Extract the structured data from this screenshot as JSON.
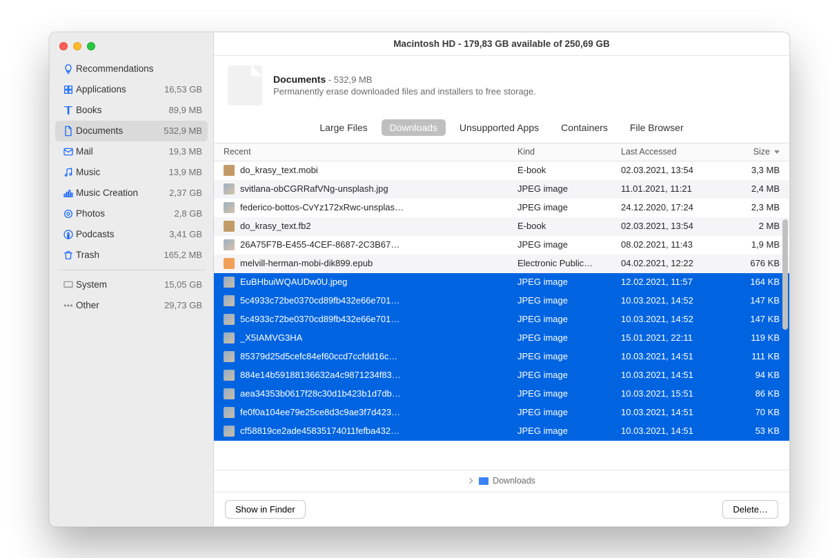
{
  "window_title": "Macintosh HD - 179,83 GB available of 250,69 GB",
  "sidebar": [
    {
      "icon": "bulb",
      "label": "Recommendations",
      "size": ""
    },
    {
      "icon": "apps",
      "label": "Applications",
      "size": "16,53 GB"
    },
    {
      "icon": "book",
      "label": "Books",
      "size": "89,9 MB"
    },
    {
      "icon": "doc",
      "label": "Documents",
      "size": "532,9 MB",
      "selected": true
    },
    {
      "icon": "mail",
      "label": "Mail",
      "size": "19,3 MB"
    },
    {
      "icon": "music",
      "label": "Music",
      "size": "13,9 MB"
    },
    {
      "icon": "musiccreation",
      "label": "Music Creation",
      "size": "2,37 GB"
    },
    {
      "icon": "photos",
      "label": "Photos",
      "size": "2,8 GB"
    },
    {
      "icon": "podcasts",
      "label": "Podcasts",
      "size": "3,41 GB"
    },
    {
      "icon": "trash",
      "label": "Trash",
      "size": "165,2 MB"
    },
    {
      "divider": true
    },
    {
      "icon": "system",
      "gray": true,
      "label": "System",
      "size": "15,05 GB"
    },
    {
      "icon": "other",
      "gray": true,
      "label": "Other",
      "size": "29,73 GB"
    }
  ],
  "header": {
    "title": "Documents",
    "title_suffix": "- 532,9 MB",
    "subtitle": "Permanently erase downloaded files and installers to free storage."
  },
  "tabs": [
    {
      "label": "Large Files"
    },
    {
      "label": "Downloads",
      "selected": true
    },
    {
      "label": "Unsupported Apps"
    },
    {
      "label": "Containers"
    },
    {
      "label": "File Browser"
    }
  ],
  "columns": {
    "name": "Recent",
    "kind": "Kind",
    "last": "Last Accessed",
    "size": "Size",
    "sort": "size-desc"
  },
  "rows": [
    {
      "thumb": "ebook",
      "name": "do_krasy_text.mobi",
      "kind": "E-book",
      "last": "02.03.2021, 13:54",
      "size": "3,3 MB",
      "selected": false
    },
    {
      "thumb": "jpeg",
      "name": "svitlana-obCGRRafVNg-unsplash.jpg",
      "kind": "JPEG image",
      "last": "11.01.2021, 11:21",
      "size": "2,4 MB",
      "selected": false
    },
    {
      "thumb": "jpeg",
      "name": "federico-bottos-CvYz172xRwc-unsplas…",
      "kind": "JPEG image",
      "last": "24.12.2020, 17:24",
      "size": "2,3 MB",
      "selected": false
    },
    {
      "thumb": "ebook",
      "name": "do_krasy_text.fb2",
      "kind": "E-book",
      "last": "02.03.2021, 13:54",
      "size": "2 MB",
      "selected": false
    },
    {
      "thumb": "jpeg",
      "name": "26A75F7B-E455-4CEF-8687-2C3B67…",
      "kind": "JPEG image",
      "last": "08.02.2021, 11:43",
      "size": "1,9 MB",
      "selected": false
    },
    {
      "thumb": "epub",
      "name": "melvill-herman-mobi-dik899.epub",
      "kind": "Electronic Public…",
      "last": "04.02.2021, 12:22",
      "size": "676 KB",
      "selected": false
    },
    {
      "thumb": "jpeg",
      "name": "EuBHbuiWQAUDw0U.jpeg",
      "kind": "JPEG image",
      "last": "12.02.2021, 11:57",
      "size": "164 KB",
      "selected": true
    },
    {
      "thumb": "jpeg",
      "name": "5c4933c72be0370cd89fb432e66e701…",
      "kind": "JPEG image",
      "last": "10.03.2021, 14:52",
      "size": "147 KB",
      "selected": true
    },
    {
      "thumb": "jpeg",
      "name": "5c4933c72be0370cd89fb432e66e701…",
      "kind": "JPEG image",
      "last": "10.03.2021, 14:52",
      "size": "147 KB",
      "selected": true
    },
    {
      "thumb": "jpeg",
      "name": "_X5IAMVG3HA",
      "kind": "JPEG image",
      "last": "15.01.2021, 22:11",
      "size": "119 KB",
      "selected": true
    },
    {
      "thumb": "jpeg",
      "name": "85379d25d5cefc84ef60ccd7ccfdd16c…",
      "kind": "JPEG image",
      "last": "10.03.2021, 14:51",
      "size": "111 KB",
      "selected": true
    },
    {
      "thumb": "jpeg",
      "name": "884e14b59188136632a4c9871234f83…",
      "kind": "JPEG image",
      "last": "10.03.2021, 14:51",
      "size": "94 KB",
      "selected": true
    },
    {
      "thumb": "jpeg",
      "name": "aea34353b0617f28c30d1b423b1d7db…",
      "kind": "JPEG image",
      "last": "10.03.2021, 15:51",
      "size": "86 KB",
      "selected": true
    },
    {
      "thumb": "jpeg",
      "name": "fe0f0a104ee79e25ce8d3c9ae3f7d423…",
      "kind": "JPEG image",
      "last": "10.03.2021, 14:51",
      "size": "70 KB",
      "selected": true
    },
    {
      "thumb": "jpeg",
      "name": "cf58819ce2ade45835174011fefba432…",
      "kind": "JPEG image",
      "last": "10.03.2021, 14:51",
      "size": "53 KB",
      "selected": true
    }
  ],
  "path_bar": {
    "label": "Downloads"
  },
  "buttons": {
    "show_in_finder": "Show in Finder",
    "delete": "Delete…"
  }
}
